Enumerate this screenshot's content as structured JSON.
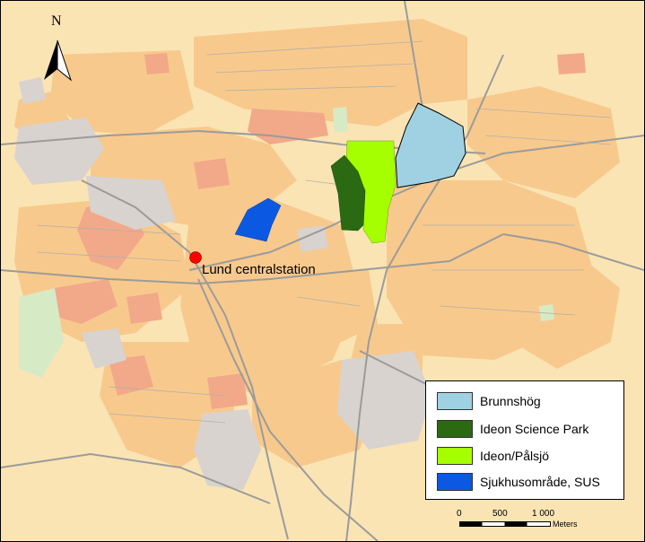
{
  "map": {
    "colors": {
      "background": "#fae4b4",
      "residential": "#f8c98d",
      "dense": "#f1a98a",
      "industrial": "#d8d3cf",
      "park": "#d6ebc5",
      "road": "#9b9b9b"
    },
    "north_arrow": {
      "label": "N",
      "icon": "north-arrow-icon"
    },
    "station": {
      "label": "Lund centralstation",
      "marker_color": "#ff0000"
    }
  },
  "legend": {
    "items": [
      {
        "label": "Brunnshög",
        "color": "#9fd1e3"
      },
      {
        "label": "Ideon Science Park",
        "color": "#2b6a12"
      },
      {
        "label": "Ideon/Pålsjö",
        "color": "#a6ff00"
      },
      {
        "label": "Sjukhusområde, SUS",
        "color": "#0b59e3"
      }
    ]
  },
  "scale_bar": {
    "ticks": [
      "0",
      "500",
      "1 000"
    ],
    "unit": "Meters"
  }
}
